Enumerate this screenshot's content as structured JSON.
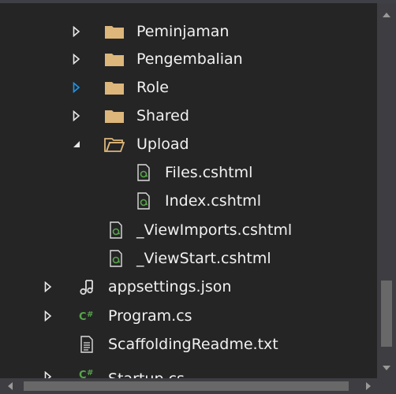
{
  "tree": {
    "rows": [
      {
        "label": "Peminjaman",
        "icon": "folder-icon",
        "expander": "collapsed"
      },
      {
        "label": "Pengembalian",
        "icon": "folder-icon",
        "expander": "collapsed"
      },
      {
        "label": "Role",
        "icon": "folder-icon",
        "expander": "collapsed-hover"
      },
      {
        "label": "Shared",
        "icon": "folder-icon",
        "expander": "collapsed"
      },
      {
        "label": "Upload",
        "icon": "open-folder-icon",
        "expander": "expanded"
      },
      {
        "label": "Files.cshtml",
        "icon": "razor-file-icon",
        "expander": "none"
      },
      {
        "label": "Index.cshtml",
        "icon": "razor-file-icon",
        "expander": "none"
      },
      {
        "label": "_ViewImports.cshtml",
        "icon": "razor-file-icon",
        "expander": "none"
      },
      {
        "label": "_ViewStart.cshtml",
        "icon": "razor-file-icon",
        "expander": "none"
      },
      {
        "label": "appsettings.json",
        "icon": "json-file-icon",
        "expander": "collapsed"
      },
      {
        "label": "Program.cs",
        "icon": "csharp-file-icon",
        "expander": "collapsed"
      },
      {
        "label": "ScaffoldingReadme.txt",
        "icon": "text-file-icon",
        "expander": "none"
      },
      {
        "label": "Startup.cs",
        "icon": "csharp-file-icon",
        "expander": "collapsed"
      }
    ]
  },
  "colors": {
    "background": "#252526",
    "text": "#f1f1f1",
    "folder": "#dcb67a",
    "expander": "#e8e8e8",
    "expander_hover": "#1c97ea",
    "csharp": "#57a64a",
    "razor": "#57a64a",
    "scrollbar_track": "#3e3e42",
    "scrollbar_thumb": "#686868"
  }
}
